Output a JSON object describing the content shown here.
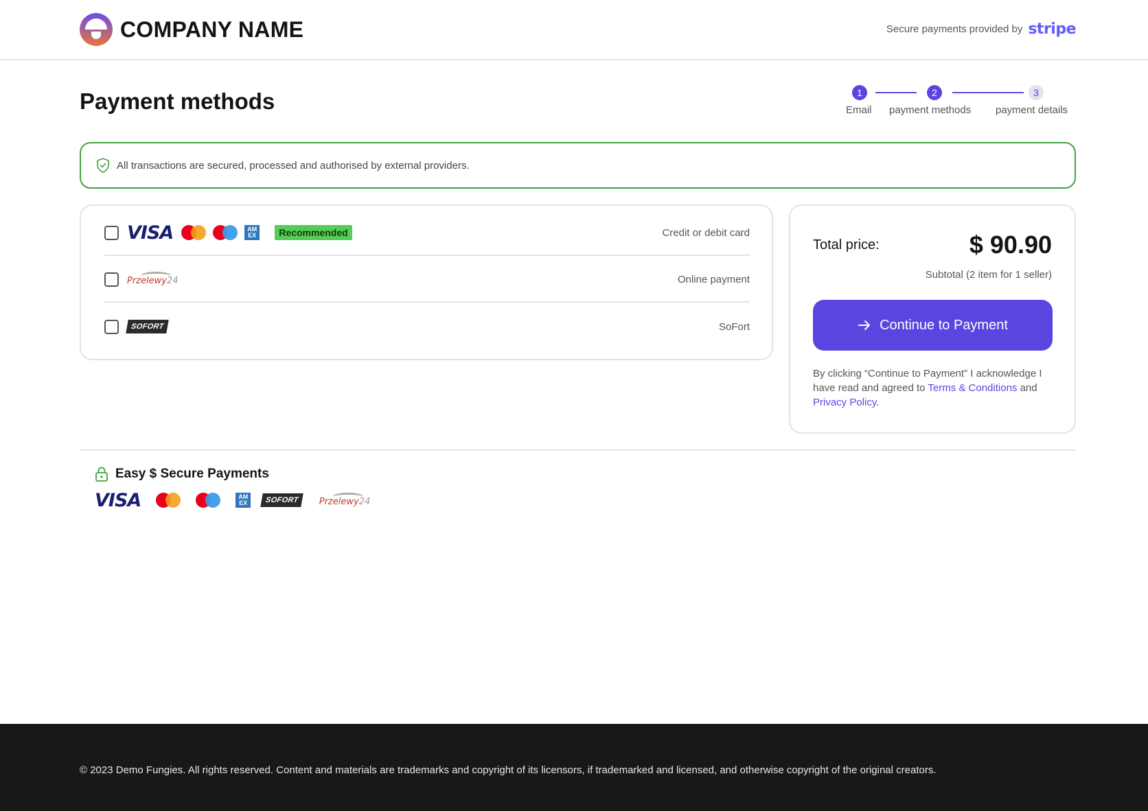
{
  "header": {
    "company_name": "COMPANY NAME",
    "secure_text": "Secure payments provided by",
    "stripe_logo": "stripe"
  },
  "page": {
    "title": "Payment methods"
  },
  "stepper": {
    "steps": [
      {
        "number": "1",
        "label": "Email",
        "state": "done"
      },
      {
        "number": "2",
        "label": "payment methods",
        "state": "current"
      },
      {
        "number": "3",
        "label": "payment details",
        "state": "upcoming"
      }
    ]
  },
  "notice": {
    "icon": "shield-check-icon",
    "text": "All transactions are secured, processed and authorised by external providers."
  },
  "methods": [
    {
      "label": "Credit or debit card",
      "badge": "Recommended",
      "logos": [
        "VISA",
        "mastercard",
        "maestro",
        "amex"
      ],
      "checked": false
    },
    {
      "label": "Online payment",
      "logos": [
        "Przelewy24"
      ],
      "checked": false
    },
    {
      "label": "SoFort",
      "logos": [
        "SOFORT"
      ],
      "checked": false
    }
  ],
  "logos": {
    "visa": "VISA",
    "amex": "AM EX",
    "sofort": "SOFORT",
    "p24_main": "Przelewy",
    "p24_num": "24"
  },
  "summary": {
    "total_label": "Total price:",
    "total_price": "$ 90.90",
    "subtotal": "Subtotal (2 item for 1 seller)",
    "cta_label": "Continue to Payment",
    "legal_prefix": "By clicking “Continue to Payment” I acknowledge I have read and agreed to ",
    "terms_link": "Terms & Conditions",
    "legal_and": " and ",
    "privacy_link": "Privacy Policy",
    "legal_suffix": "."
  },
  "secure_payments": {
    "title": "Easy $ Secure Payments",
    "icon": "lock-icon"
  },
  "footer": {
    "copyright": "© 2023 Demo Fungies. All rights reserved. Content and materials are trademarks and copyright of its licensors, if trademarked and licensed, and otherwise copyright of the original creators."
  },
  "colors": {
    "accent": "#5b45e0",
    "success": "#3fa33f",
    "recommended": "#55cc55",
    "footer_bg": "#181818"
  }
}
